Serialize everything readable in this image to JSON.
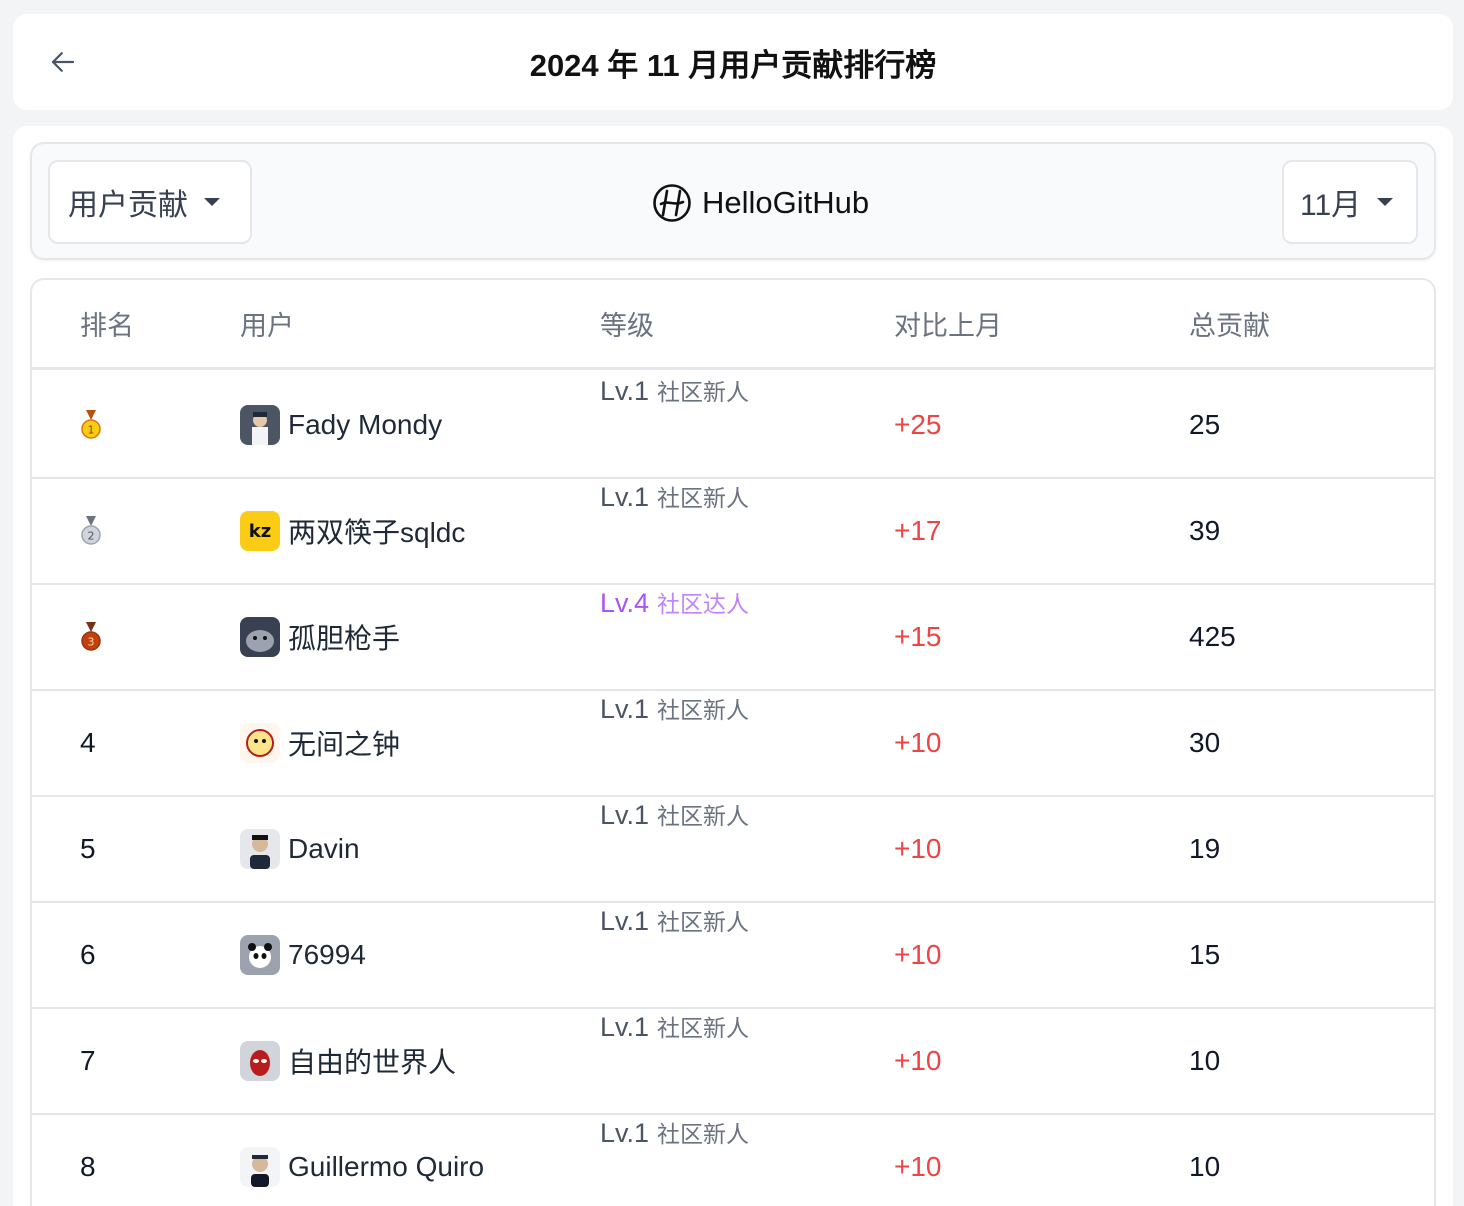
{
  "header": {
    "title": "2024 年 11 月用户贡献排行榜"
  },
  "toolbar": {
    "type_select": "用户贡献",
    "brand": "HelloGitHub",
    "month_select": "11月"
  },
  "table": {
    "columns": [
      "排名",
      "用户",
      "等级",
      "对比上月",
      "总贡献"
    ],
    "rows": [
      {
        "rank": "1",
        "medal": "gold-medal-icon",
        "user": "Fady Mondy",
        "level": "Lv.1",
        "level_name": "社区新人",
        "delta": "+25",
        "total": "25"
      },
      {
        "rank": "2",
        "medal": "silver-medal-icon",
        "user": "两双筷子sqldc",
        "level": "Lv.1",
        "level_name": "社区新人",
        "delta": "+17",
        "total": "39"
      },
      {
        "rank": "3",
        "medal": "bronze-medal-icon",
        "user": "孤胆枪手",
        "level": "Lv.4",
        "level_name": "社区达人",
        "delta": "+15",
        "total": "425"
      },
      {
        "rank": "4",
        "user": "无间之钟",
        "level": "Lv.1",
        "level_name": "社区新人",
        "delta": "+10",
        "total": "30"
      },
      {
        "rank": "5",
        "user": "Davin",
        "level": "Lv.1",
        "level_name": "社区新人",
        "delta": "+10",
        "total": "19"
      },
      {
        "rank": "6",
        "user": "76994",
        "level": "Lv.1",
        "level_name": "社区新人",
        "delta": "+10",
        "total": "15"
      },
      {
        "rank": "7",
        "user": "自由的世界人",
        "level": "Lv.1",
        "level_name": "社区新人",
        "delta": "+10",
        "total": "10"
      },
      {
        "rank": "8",
        "user": "Guillermo Quiro",
        "level": "Lv.1",
        "level_name": "社区新人",
        "delta": "+10",
        "total": "10"
      }
    ]
  },
  "colors": {
    "delta_positive": "#ef4444",
    "level_purple": "#a855f7"
  }
}
